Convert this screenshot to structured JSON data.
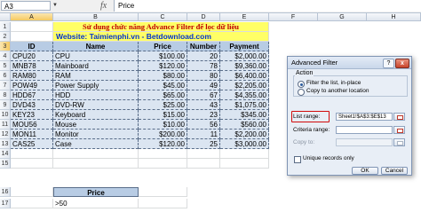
{
  "formula_bar": {
    "name_box": "A3",
    "fx": "fx",
    "content": "Price"
  },
  "columns": [
    "A",
    "B",
    "C",
    "D",
    "E",
    "F",
    "G",
    "H"
  ],
  "rows": {
    "r1": {
      "num": "1",
      "title": "Sử dụng chức năng Advance Filter để lọc dữ liệu"
    },
    "r2": {
      "num": "2",
      "website": "Website: Taimienphi.vn - Betdownload.com"
    },
    "r3": {
      "num": "3",
      "id": "ID",
      "name": "Name",
      "price": "Price",
      "number": "Number",
      "payment": "Payment"
    },
    "r4": {
      "num": "4",
      "id": "CPU20",
      "name": "CPU",
      "price": "$100.00",
      "number": "20",
      "payment": "$2,000.00"
    },
    "r5": {
      "num": "5",
      "id": "MNB78",
      "name": "Mainboard",
      "price": "$120.00",
      "number": "78",
      "payment": "$9,360.00"
    },
    "r6": {
      "num": "6",
      "id": "RAM80",
      "name": "RAM",
      "price": "$80.00",
      "number": "80",
      "payment": "$6,400.00"
    },
    "r7": {
      "num": "7",
      "id": "POW49",
      "name": "Power Supply",
      "price": "$45.00",
      "number": "49",
      "payment": "$2,205.00"
    },
    "r8": {
      "num": "8",
      "id": "HDD67",
      "name": "HDD",
      "price": "$65.00",
      "number": "67",
      "payment": "$4,355.00"
    },
    "r9": {
      "num": "9",
      "id": "DVD43",
      "name": "DVD-RW",
      "price": "$25.00",
      "number": "43",
      "payment": "$1,075.00"
    },
    "r10": {
      "num": "10",
      "id": "KEY23",
      "name": "Keyboard",
      "price": "$15.00",
      "number": "23",
      "payment": "$345.00"
    },
    "r11": {
      "num": "11",
      "id": "MOU56",
      "name": "Mouse",
      "price": "$10.00",
      "number": "56",
      "payment": "$560.00"
    },
    "r12": {
      "num": "12",
      "id": "MON11",
      "name": "Monitor",
      "price": "$200.00",
      "number": "11",
      "payment": "$2,200.00"
    },
    "r13": {
      "num": "13",
      "id": "CAS25",
      "name": "Case",
      "price": "$120.00",
      "number": "25",
      "payment": "$3,000.00"
    },
    "r14": {
      "num": "14"
    },
    "r15": {
      "num": "15"
    },
    "r16": {
      "num": "16",
      "criteria_header": "Price"
    },
    "r17": {
      "num": "17",
      "criteria_value": ">50"
    }
  },
  "dialog": {
    "title": "Advanced Filter",
    "help": "?",
    "close": "x",
    "action_label": "Action",
    "radio_in_place": "Filter the list, in-place",
    "radio_copy": "Copy to another location",
    "radio_in_place_selected": true,
    "list_range_label": "List range:",
    "list_range_value": "Sheet1!$A$3:$E$13",
    "criteria_range_label": "Criteria range:",
    "criteria_range_value": "",
    "copy_to_label": "Copy to:",
    "copy_to_value": "",
    "unique_label": "Unique records only",
    "unique_checked": false,
    "ok_label": "OK",
    "cancel_label": "Cancel"
  },
  "colors": {
    "title_bg": "#ffff66",
    "title_text": "#c00000",
    "website_text": "#0033cc",
    "table_bg": "#dbe5f1",
    "header_bg": "#b8cce4",
    "highlight": "#d10a0a"
  }
}
